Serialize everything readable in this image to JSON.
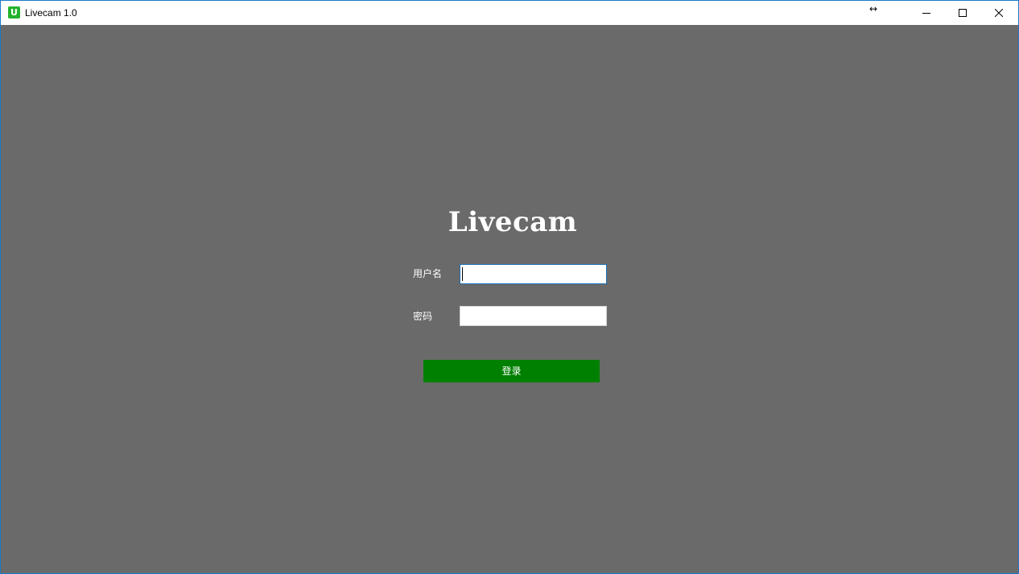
{
  "window": {
    "title": "Livecam 1.0",
    "app_icon_glyph": "U",
    "resize_glyph": "↔",
    "icons": {
      "app": "app-logo-icon",
      "resize": "resize-horizontal-icon",
      "minimize": "minimize-icon",
      "maximize": "maximize-icon",
      "close": "close-icon"
    }
  },
  "login": {
    "logo_text": "Livecam",
    "username_label": "用户名",
    "username_value": "",
    "password_label": "密码",
    "password_value": "",
    "submit_label": "登录"
  },
  "colors": {
    "background": "#6a6a6a",
    "titlebar": "#ffffff",
    "window_border": "#1979ca",
    "focused_field_border": "#1b6fb5",
    "login_button": "#008000",
    "app_icon": "#25b22e",
    "text_on_dark": "#ffffff"
  }
}
